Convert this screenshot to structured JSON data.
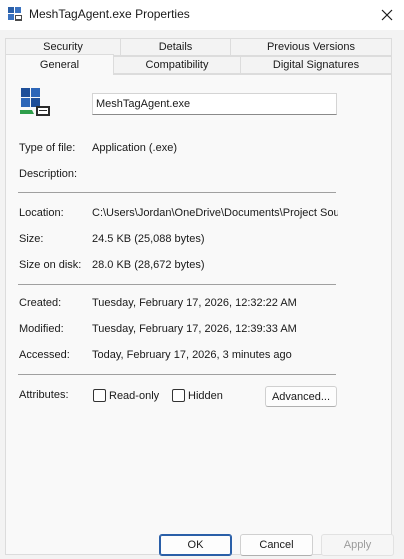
{
  "window": {
    "title": "MeshTagAgent.exe Properties",
    "icon": "application-icon",
    "close_icon": "close-icon"
  },
  "tabs": {
    "row1": [
      {
        "label": "Security"
      },
      {
        "label": "Details"
      },
      {
        "label": "Previous Versions"
      }
    ],
    "row2": [
      {
        "label": "General",
        "active": true
      },
      {
        "label": "Compatibility"
      },
      {
        "label": "Digital Signatures"
      }
    ]
  },
  "general": {
    "file_name": "MeshTagAgent.exe",
    "type_label": "Type of file:",
    "type_value": "Application (.exe)",
    "description_label": "Description:",
    "description_value": "",
    "location_label": "Location:",
    "location_value": "C:\\Users\\Jordan\\OneDrive\\Documents\\Project Sou",
    "size_label": "Size:",
    "size_value": "24.5 KB (25,088 bytes)",
    "size_on_disk_label": "Size on disk:",
    "size_on_disk_value": "28.0 KB (28,672 bytes)",
    "created_label": "Created:",
    "created_value": "Tuesday, February 17, 2026, 12:32:22 AM",
    "modified_label": "Modified:",
    "modified_value": "Tuesday, February 17, 2026, 12:39:33 AM",
    "accessed_label": "Accessed:",
    "accessed_value": "Today, February 17, 2026, 3 minutes ago",
    "attributes_label": "Attributes:",
    "readonly_label": "Read-only",
    "readonly_checked": false,
    "hidden_label": "Hidden",
    "hidden_checked": false,
    "advanced_label": "Advanced..."
  },
  "buttons": {
    "ok": "OK",
    "cancel": "Cancel",
    "apply": "Apply"
  },
  "colors": {
    "accent": "#2a5fa8",
    "dialog_bg": "#f3f3f3",
    "panel_bg": "#f9f9f9"
  }
}
